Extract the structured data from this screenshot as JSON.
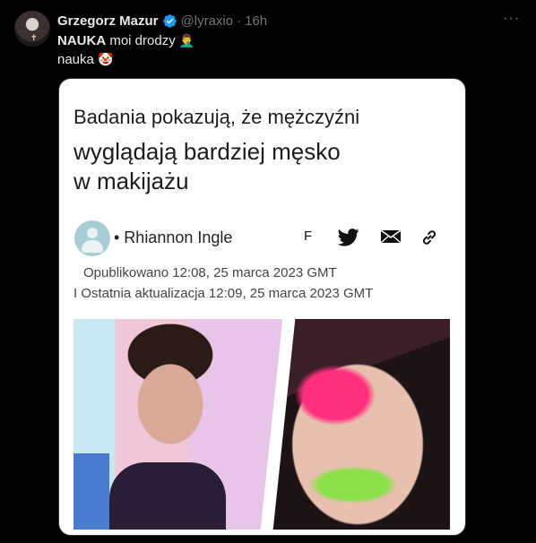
{
  "tweet": {
    "name": "Grzegorz Mazur",
    "handle": "@lyraxio",
    "separator": "·",
    "time": "16h",
    "more": "···",
    "line1_bold": "NAUKA",
    "line1_rest": " moi drodzy",
    "line1_emoji": "🤦‍♂️",
    "line2": "nauka",
    "line2_emoji": "🤡"
  },
  "article": {
    "headline_line1": "Badania pokazują, że mężczyźni",
    "headline_line2": "wyglądają bardziej męsko",
    "headline_line3": "w makijażu",
    "author": "• Rhiannon Ingle",
    "share_f": "F",
    "published": "Opublikowano 12:08, 25 marca 2023 GMT",
    "updated": "I Ostatnia aktualizacja 12:09, 25 marca 2023 GMT"
  },
  "colors": {
    "background": "#000000",
    "text": "#e7e9ea",
    "muted": "#71767b",
    "verified": "#1d9bf0"
  },
  "icons": [
    "verified-badge-icon",
    "more-icon",
    "twitter-icon",
    "mail-icon",
    "link-icon",
    "user-placeholder-icon"
  ]
}
